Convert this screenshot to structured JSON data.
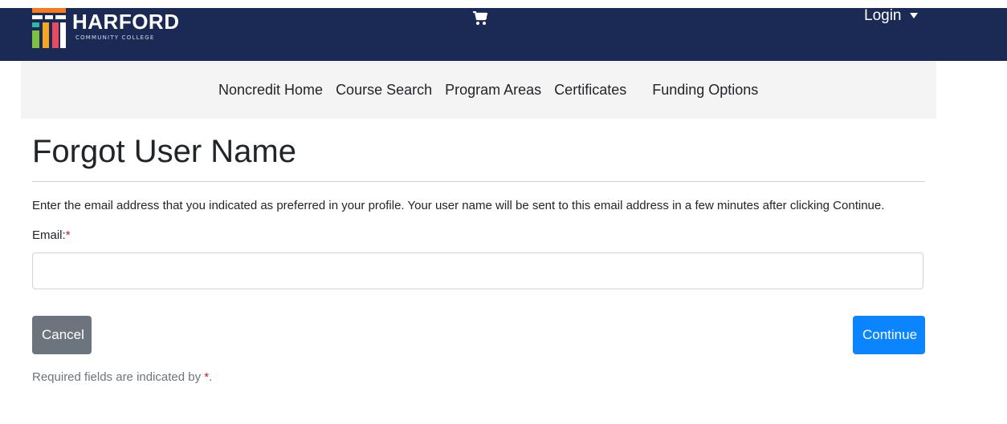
{
  "header": {
    "logo_name": "HARFORD",
    "logo_sub": "COMMUNITY COLLEGE",
    "cart_icon": "cart-icon",
    "login_label": "Login",
    "login_caret_icon": "caret-down-icon",
    "colors": {
      "background": "#1b2a55",
      "text": "#ffffff"
    }
  },
  "nav": {
    "items": [
      {
        "label": "Noncredit Home"
      },
      {
        "label": "Course Search"
      },
      {
        "label": "Program Areas"
      },
      {
        "label": "Certificates"
      },
      {
        "label": "Funding Options"
      }
    ]
  },
  "page": {
    "title": "Forgot User Name",
    "instructions": "Enter the email address that you indicated as preferred in your profile. Your user name will be sent to this email address in a few minutes after clicking Continue.",
    "email_label": "Email:",
    "required_mark": "*",
    "email_value": "",
    "email_placeholder": "",
    "cancel_label": "Cancel",
    "continue_label": "Continue",
    "required_note_prefix": "Required fields are indicated by ",
    "required_note_suffix": ".",
    "colors": {
      "cancel": "#6c757d",
      "continue": "#0a84ff",
      "required": "#c0192d"
    }
  }
}
